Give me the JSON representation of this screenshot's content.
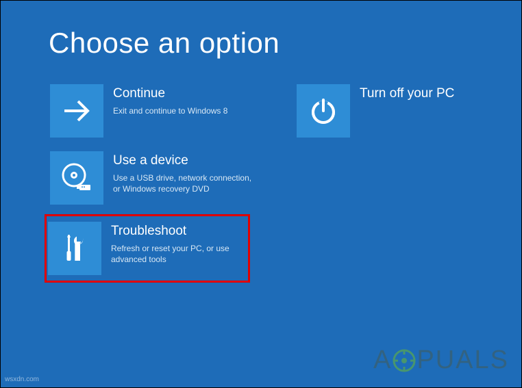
{
  "page": {
    "title": "Choose an option"
  },
  "options": {
    "continue": {
      "title": "Continue",
      "desc": "Exit and continue to Windows 8"
    },
    "use_device": {
      "title": "Use a device",
      "desc": "Use a USB drive, network connection, or Windows recovery DVD"
    },
    "troubleshoot": {
      "title": "Troubleshoot",
      "desc": "Refresh or reset your PC, or use advanced tools"
    },
    "turn_off": {
      "title": "Turn off your PC",
      "desc": ""
    }
  },
  "watermark": {
    "prefix": "A",
    "suffix": "PUALS"
  },
  "source": "wsxdn.com"
}
